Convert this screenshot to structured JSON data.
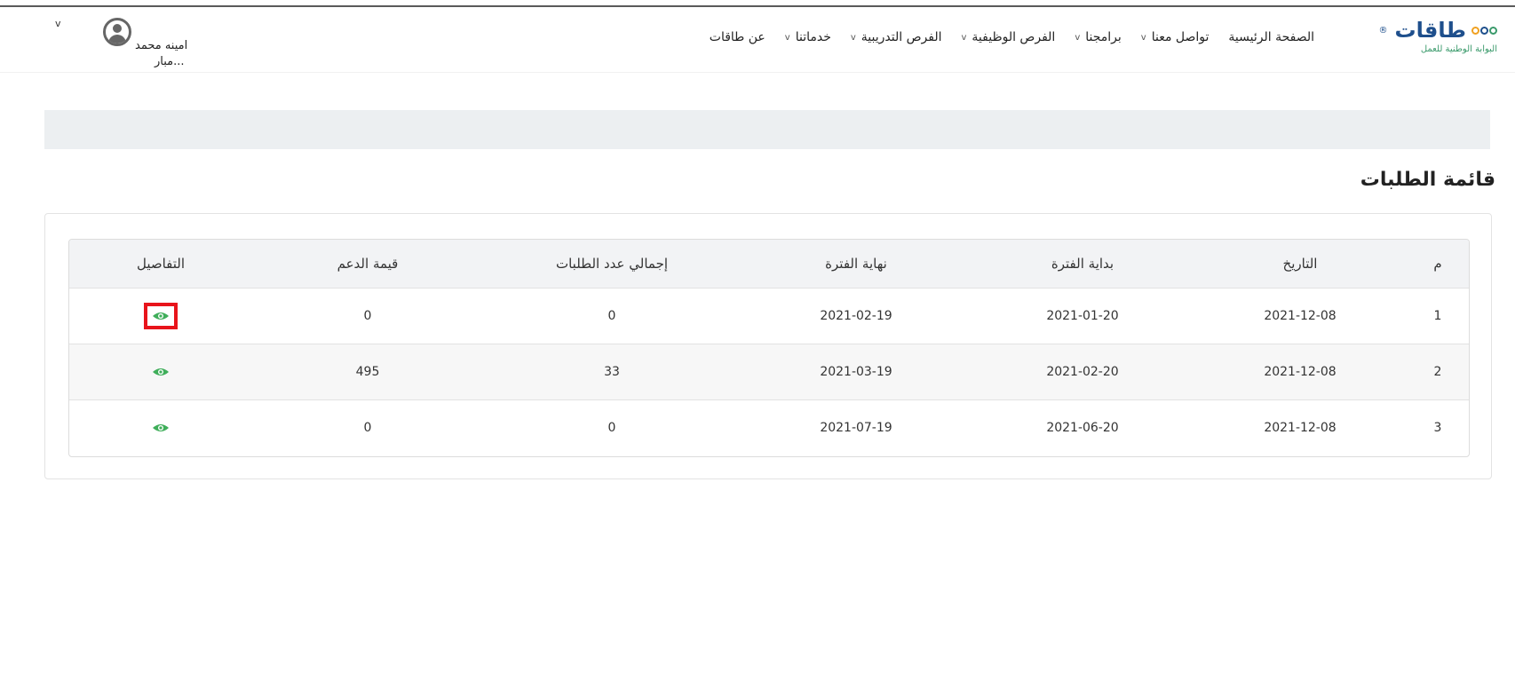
{
  "header": {
    "logo": {
      "name": "طاقات",
      "subtitle": "البوابة الوطنية للعمل"
    },
    "nav": [
      {
        "label": "الصفحة الرئيسية",
        "has_dropdown": false
      },
      {
        "label": "تواصل معنا",
        "has_dropdown": true
      },
      {
        "label": "برامجنا",
        "has_dropdown": true
      },
      {
        "label": "الفرص الوظيفية",
        "has_dropdown": true
      },
      {
        "label": "الفرص التدريبية",
        "has_dropdown": true
      },
      {
        "label": "خدماتنا",
        "has_dropdown": true
      },
      {
        "label": "عن طاقات",
        "has_dropdown": false
      }
    ],
    "user": {
      "name": "امينه محمد",
      "subtitle": "...مبار"
    }
  },
  "page": {
    "title": "قائمة الطلبات"
  },
  "table": {
    "headers": [
      "م",
      "التاريخ",
      "بداية الفترة",
      "نهاية الفترة",
      "إجمالي عدد الطلبات",
      "قيمة الدعم",
      "التفاصيل"
    ],
    "rows": [
      {
        "index": "1",
        "date": "2021-12-08",
        "start": "2021-01-20",
        "end": "2021-02-19",
        "total": "0",
        "value": "0",
        "highlighted": true
      },
      {
        "index": "2",
        "date": "2021-12-08",
        "start": "2021-02-20",
        "end": "2021-03-19",
        "total": "33",
        "value": "495",
        "highlighted": false
      },
      {
        "index": "3",
        "date": "2021-12-08",
        "start": "2021-06-20",
        "end": "2021-07-19",
        "total": "0",
        "value": "0",
        "highlighted": false
      }
    ]
  },
  "colors": {
    "eye": "#3fae5a",
    "highlight": "#e8141b",
    "brand": "#1e4f8c"
  }
}
